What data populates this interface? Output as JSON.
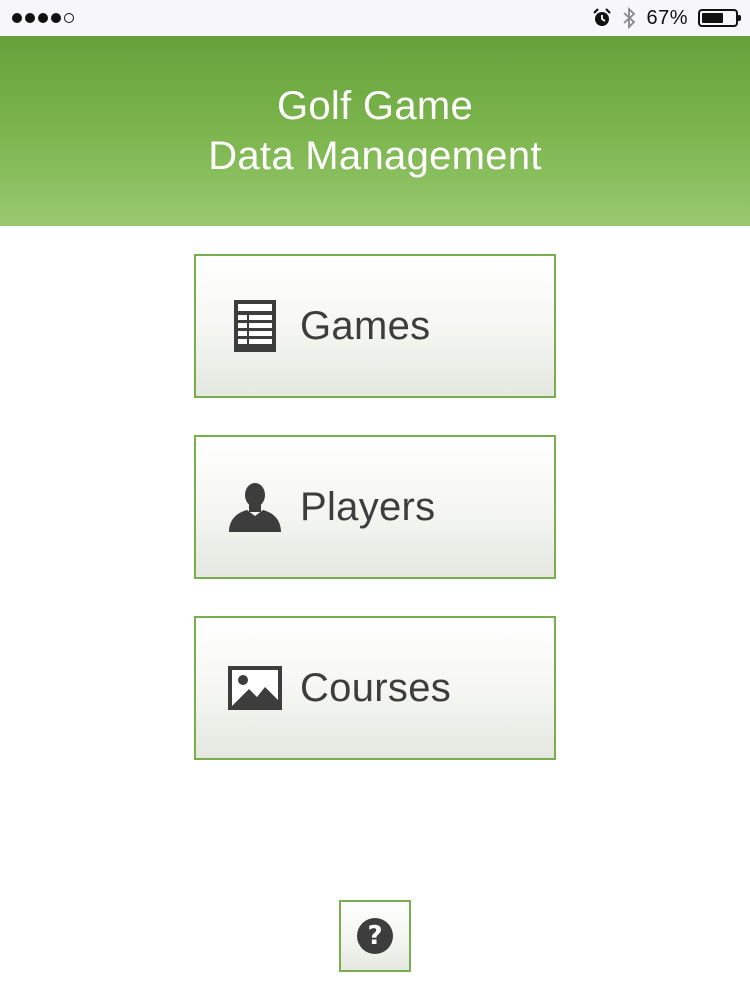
{
  "status_bar": {
    "signal_dots_filled": 4,
    "signal_dots_total": 5,
    "icons": [
      "alarm-icon",
      "bluetooth-icon"
    ],
    "battery_percent_text": "67%",
    "battery_level": 0.67
  },
  "header": {
    "line1": "Golf Game",
    "line2": "Data Management",
    "gradient": [
      "#65a03a",
      "#98c870"
    ]
  },
  "menu": {
    "games": {
      "label": "Games",
      "icon": "table-icon"
    },
    "players": {
      "label": "Players",
      "icon": "person-icon"
    },
    "courses": {
      "label": "Courses",
      "icon": "image-icon"
    }
  },
  "help": {
    "label": "?",
    "icon": "help-icon"
  },
  "colors": {
    "accent_border": "#79ae4f",
    "icon_dark": "#3d3d3d"
  }
}
